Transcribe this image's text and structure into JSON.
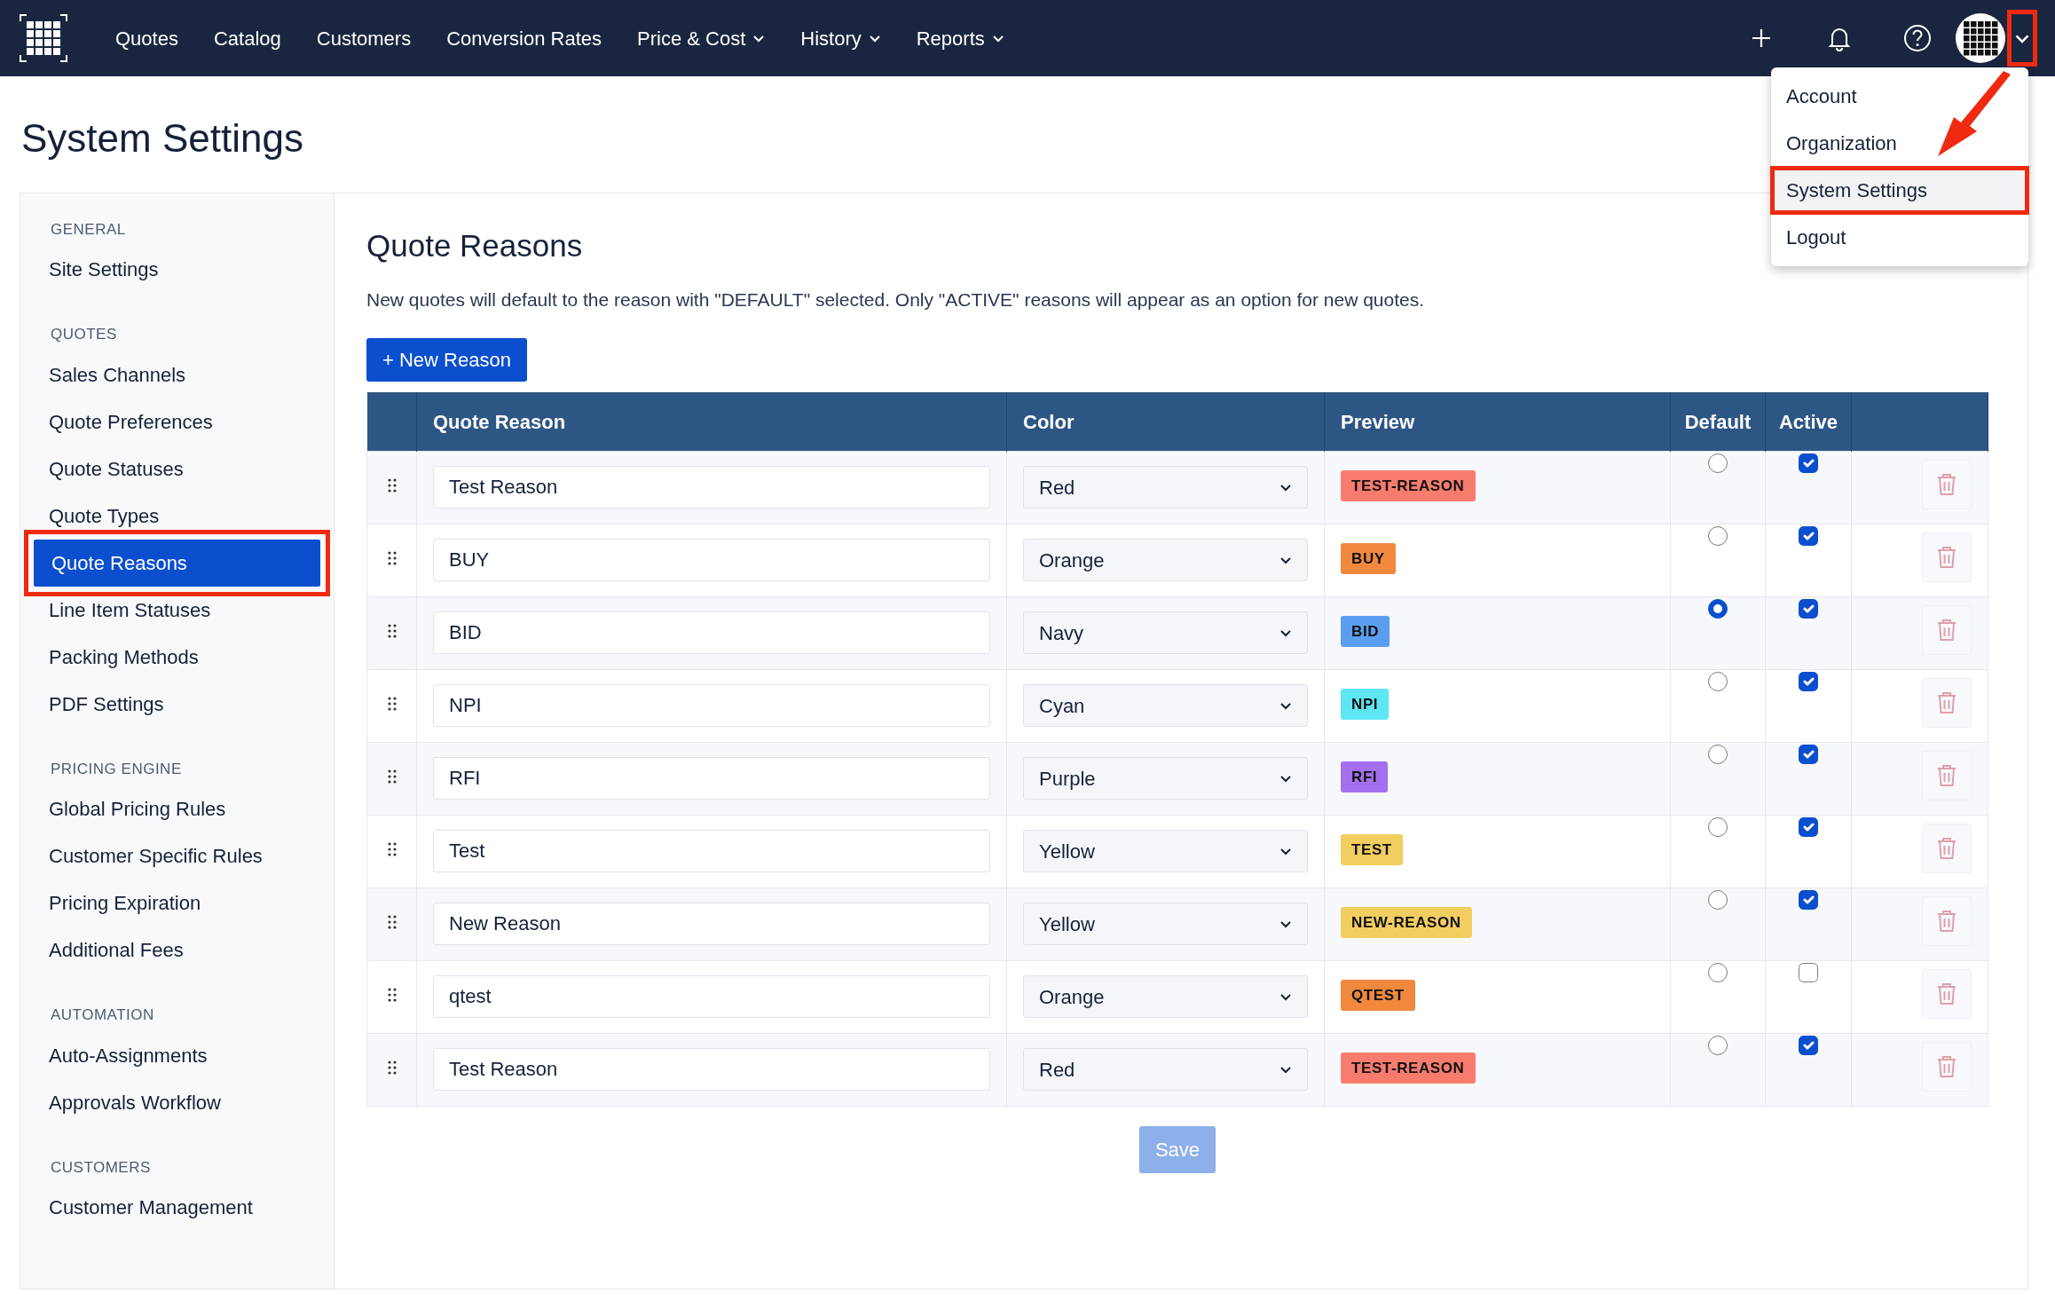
{
  "navbar": {
    "links": [
      {
        "label": "Quotes",
        "dropdown": false
      },
      {
        "label": "Catalog",
        "dropdown": false
      },
      {
        "label": "Customers",
        "dropdown": false
      },
      {
        "label": "Conversion Rates",
        "dropdown": false
      },
      {
        "label": "Price & Cost",
        "dropdown": true
      },
      {
        "label": "History",
        "dropdown": true
      },
      {
        "label": "Reports",
        "dropdown": true
      }
    ],
    "user_toggle": {
      "expanded": true,
      "annotated": true
    }
  },
  "user_menu": {
    "items": [
      {
        "label": "Account",
        "selected": false,
        "annotated": false
      },
      {
        "label": "Organization",
        "selected": false,
        "annotated": false
      },
      {
        "label": "System Settings",
        "selected": true,
        "annotated": true
      },
      {
        "label": "Logout",
        "selected": false,
        "annotated": false
      }
    ]
  },
  "page_title": "System Settings",
  "sidebar": {
    "sections": [
      {
        "heading": "GENERAL",
        "items": [
          {
            "label": "Site Settings",
            "selected": false,
            "annotated": false
          }
        ]
      },
      {
        "heading": "QUOTES",
        "items": [
          {
            "label": "Sales Channels",
            "selected": false,
            "annotated": false
          },
          {
            "label": "Quote Preferences",
            "selected": false,
            "annotated": false
          },
          {
            "label": "Quote Statuses",
            "selected": false,
            "annotated": false
          },
          {
            "label": "Quote Types",
            "selected": false,
            "annotated": false
          },
          {
            "label": "Quote Reasons",
            "selected": true,
            "annotated": true
          },
          {
            "label": "Line Item Statuses",
            "selected": false,
            "annotated": false
          },
          {
            "label": "Packing Methods",
            "selected": false,
            "annotated": false
          },
          {
            "label": "PDF Settings",
            "selected": false,
            "annotated": false
          }
        ]
      },
      {
        "heading": "PRICING ENGINE",
        "items": [
          {
            "label": "Global Pricing Rules",
            "selected": false,
            "annotated": false
          },
          {
            "label": "Customer Specific Rules",
            "selected": false,
            "annotated": false
          },
          {
            "label": "Pricing Expiration",
            "selected": false,
            "annotated": false
          },
          {
            "label": "Additional Fees",
            "selected": false,
            "annotated": false
          }
        ]
      },
      {
        "heading": "AUTOMATION",
        "items": [
          {
            "label": "Auto-Assignments",
            "selected": false,
            "annotated": false
          },
          {
            "label": "Approvals Workflow",
            "selected": false,
            "annotated": false
          }
        ]
      },
      {
        "heading": "CUSTOMERS",
        "items": [
          {
            "label": "Customer Management",
            "selected": false,
            "annotated": false
          }
        ]
      }
    ]
  },
  "content": {
    "title": "Quote Reasons",
    "description": "New quotes will default to the reason with \"DEFAULT\" selected. Only \"ACTIVE\" reasons will appear as an option for new quotes.",
    "new_button": "+ New Reason",
    "table": {
      "columns": [
        "Quote Reason",
        "Color",
        "Preview",
        "Default",
        "Active"
      ],
      "rows": [
        {
          "reason": "Test Reason",
          "color_name": "Red",
          "preview": "TEST-REASON",
          "color": "#f87c6e",
          "default": false,
          "active": true
        },
        {
          "reason": "BUY",
          "color_name": "Orange",
          "preview": "BUY",
          "color": "#f0883e",
          "default": false,
          "active": true
        },
        {
          "reason": "BID",
          "color_name": "Navy",
          "preview": "BID",
          "color": "#5b9ef0",
          "default": true,
          "active": true
        },
        {
          "reason": "NPI",
          "color_name": "Cyan",
          "preview": "NPI",
          "color": "#5ee6f2",
          "default": false,
          "active": true
        },
        {
          "reason": "RFI",
          "color_name": "Purple",
          "preview": "RFI",
          "color": "#a46ff0",
          "default": false,
          "active": true
        },
        {
          "reason": "Test",
          "color_name": "Yellow",
          "preview": "TEST",
          "color": "#f2cd60",
          "default": false,
          "active": true
        },
        {
          "reason": "New Reason",
          "color_name": "Yellow",
          "preview": "NEW-REASON",
          "color": "#f2cd60",
          "default": false,
          "active": true
        },
        {
          "reason": "qtest",
          "color_name": "Orange",
          "preview": "QTEST",
          "color": "#f0883e",
          "default": false,
          "active": false
        },
        {
          "reason": "Test Reason",
          "color_name": "Red",
          "preview": "TEST-REASON",
          "color": "#f87c6e",
          "default": false,
          "active": true
        }
      ]
    },
    "save_button": {
      "label": "Save",
      "disabled": true
    }
  }
}
